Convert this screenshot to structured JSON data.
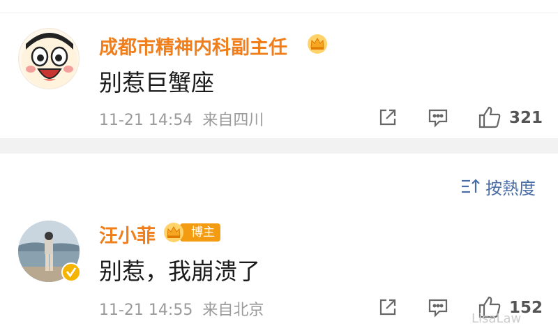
{
  "comments": [
    {
      "author": "成都市精神内科副主任",
      "text": "别惹巨蟹座",
      "time": "11-21 14:54",
      "location": "来自四川",
      "likes": "321",
      "badge_icon": "crown-icon",
      "avatar_icon": "cartoon-face-avatar"
    },
    {
      "author": "汪小菲",
      "badge_label": "博主",
      "text": "别惹，我崩溃了",
      "time": "11-21 14:55",
      "location": "来自北京",
      "likes": "152",
      "badge_icon": "crown-icon",
      "avatar_icon": "photo-avatar-verified"
    }
  ],
  "sort": {
    "label": "按熱度",
    "icon": "sort-icon"
  },
  "watermark": "LisaLaw",
  "colors": {
    "author_name": "#f07e1b",
    "link_blue": "#4a6da6",
    "meta_gray": "#9a9a9a",
    "separator": "#f2f2f2"
  }
}
